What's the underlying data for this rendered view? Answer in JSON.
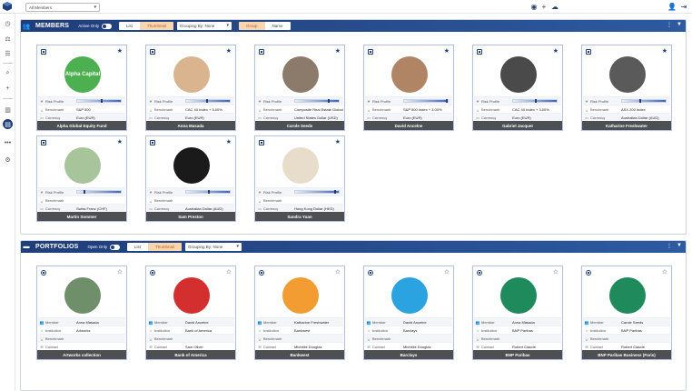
{
  "topbar": {
    "member_select": "All Members"
  },
  "members": {
    "title": "MEMBERS",
    "active_only_label": "Active Only",
    "view_options": [
      "List",
      "Thumbnail"
    ],
    "selected_view": "Thumbnail",
    "grouping": "Grouping By: None",
    "sort_options": [
      "Group",
      "Name"
    ],
    "row_labels": {
      "risk": "Risk Profile",
      "benchmark": "Benchmark",
      "currency": "Currency"
    },
    "cards": [
      {
        "name": "Alpha Global Equity Fund",
        "avatar_text": "Alpha Capital",
        "avatar_color": "#4caf50",
        "benchmark": "S&P 500",
        "currency": "Euro (EUR)",
        "risk": 0.55
      },
      {
        "name": "Anna Masada",
        "avatar_text": "",
        "avatar_color": "#d9b48f",
        "benchmark": "CAC 40 Index + 5.00%",
        "currency": "Euro (EUR)",
        "risk": 0.45
      },
      {
        "name": "Carole Seeds",
        "avatar_text": "",
        "avatar_color": "#8c7a6b",
        "benchmark": "Composite Real Estate Global",
        "currency": "United States Dollar (USD)",
        "risk": 0.75
      },
      {
        "name": "David Ancelne",
        "avatar_text": "",
        "avatar_color": "#b08565",
        "benchmark": "S&P 500 Index + 3.00%",
        "currency": "Euro (EUR)",
        "risk": 0.95
      },
      {
        "name": "Gabriel Jacquet",
        "avatar_text": "",
        "avatar_color": "#4a4a4a",
        "benchmark": "CAC 40 Index + 3.00%",
        "currency": "Euro (EUR)",
        "risk": 0.5
      },
      {
        "name": "Katharine Freshwater",
        "avatar_text": "",
        "avatar_color": "#5a5a5a",
        "benchmark": "ASX 200 Index",
        "currency": "Australian Dollar (AUD)",
        "risk": 0.4
      },
      {
        "name": "Martin Sommer",
        "avatar_text": "",
        "avatar_color": "#a8c49a",
        "benchmark": "",
        "currency": "Swiss Franc (CHF)",
        "risk": 0.15
      },
      {
        "name": "Sam Preston",
        "avatar_text": "",
        "avatar_color": "#1a1a1a",
        "benchmark": "",
        "currency": "Australian Dollar (AUD)",
        "risk": 0.5
      },
      {
        "name": "Sandra Yuan",
        "avatar_text": "",
        "avatar_color": "#e8dccb",
        "benchmark": "",
        "currency": "Hong Kong Dollar (HKD)",
        "risk": 0.9
      }
    ]
  },
  "portfolios": {
    "title": "PORTFOLIOS",
    "open_only_label": "Open Only",
    "view_options": [
      "List",
      "Thumbnail"
    ],
    "selected_view": "Thumbnail",
    "grouping": "Grouping By: None",
    "row_labels": {
      "member": "Member",
      "institution": "Institution",
      "benchmark": "Benchmark",
      "contact": "Contact"
    },
    "cards": [
      {
        "name": "Artworks collection",
        "member": "Anna Masada",
        "institution": "Artworks",
        "benchmark": "",
        "contact": "",
        "avatar_color": "#6f8f6a"
      },
      {
        "name": "Bank of America",
        "member": "David Ancelne",
        "institution": "Bank of America",
        "benchmark": "",
        "contact": "Sam Oliver",
        "avatar_color": "#d32f2f"
      },
      {
        "name": "Bankwest",
        "member": "Katharine Freshwater",
        "institution": "Bankwest",
        "benchmark": "",
        "contact": "Michelle Douglas",
        "avatar_color": "#f39c32"
      },
      {
        "name": "Barclays",
        "member": "David Ancelne",
        "institution": "Barclays",
        "benchmark": "",
        "contact": "Michelle Douglas",
        "avatar_color": "#2aa3e0"
      },
      {
        "name": "BNP Paribas",
        "member": "Anna Masada",
        "institution": "BNP Paribas",
        "benchmark": "",
        "contact": "Robert Claude",
        "avatar_color": "#1f8a5b"
      },
      {
        "name": "BNP Paribas Business (Paris)",
        "member": "Carole Seeds",
        "institution": "BNP Paribas",
        "benchmark": "",
        "contact": "Robert Claude",
        "avatar_color": "#1f8a5b"
      }
    ]
  }
}
